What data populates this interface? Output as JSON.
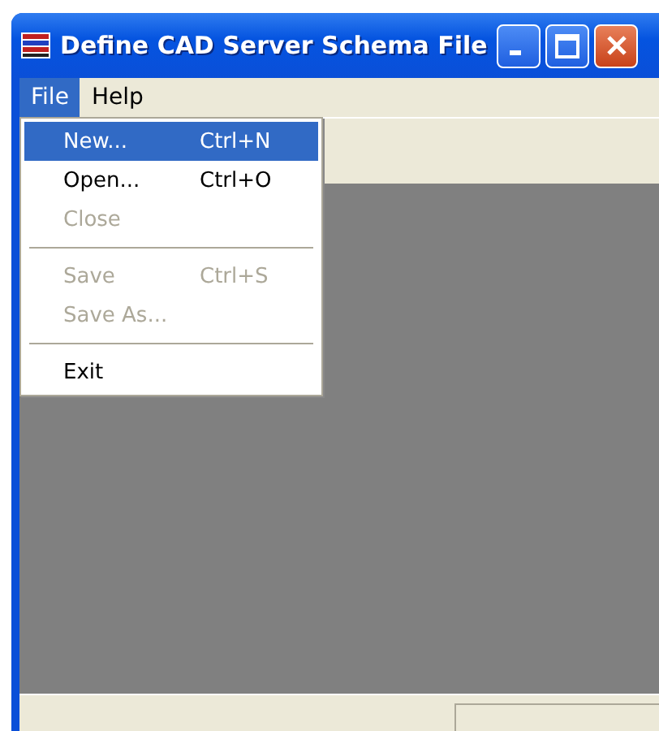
{
  "window": {
    "title": "Define CAD Server Schema File"
  },
  "menu_bar": [
    {
      "label": "File",
      "selected": true
    },
    {
      "label": "Help",
      "selected": false
    }
  ],
  "file_menu": [
    {
      "kind": "item",
      "label": "New...",
      "shortcut": "Ctrl+N",
      "selected": true,
      "disabled": false
    },
    {
      "kind": "item",
      "label": "Open...",
      "shortcut": "Ctrl+O",
      "selected": false,
      "disabled": false
    },
    {
      "kind": "item",
      "label": "Close",
      "selected": false,
      "disabled": true
    },
    {
      "kind": "separator"
    },
    {
      "kind": "item",
      "label": "Save",
      "shortcut": "Ctrl+S",
      "selected": false,
      "disabled": true
    },
    {
      "kind": "item",
      "label": "Save As...",
      "selected": false,
      "disabled": true
    },
    {
      "kind": "separator"
    },
    {
      "kind": "item",
      "label": "Exit",
      "selected": false,
      "disabled": false
    }
  ]
}
